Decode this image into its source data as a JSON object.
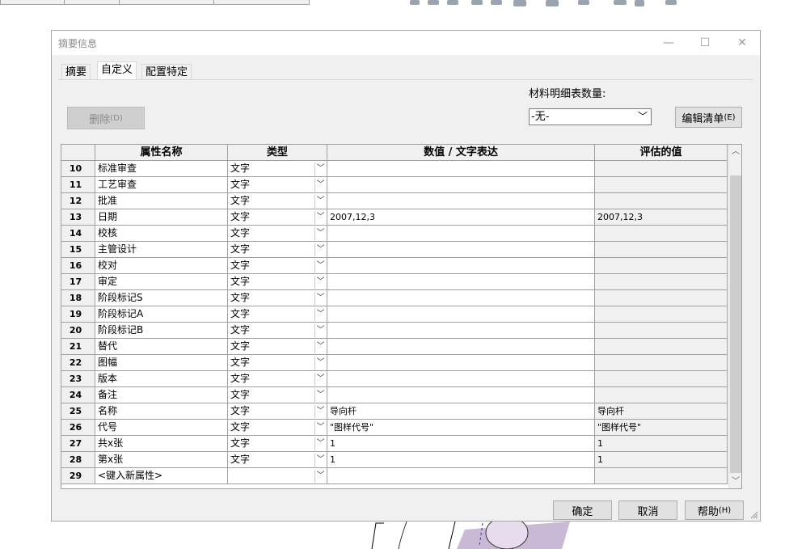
{
  "dialog": {
    "title": "摘要信息",
    "window_controls": {
      "minimize": "—",
      "maximize": "☐",
      "close": "✕"
    }
  },
  "tabs": [
    {
      "label": "摘要",
      "active": false
    },
    {
      "label": "自定义",
      "active": true
    },
    {
      "label": "配置特定",
      "active": false
    }
  ],
  "toolbar": {
    "delete_label": "删除",
    "delete_shortcut": "(D)",
    "bom_label": "材料明细表数量:",
    "bom_value": "-无-",
    "edit_label": "编辑清单",
    "edit_shortcut": "(E)"
  },
  "grid": {
    "headers": {
      "name": "属性名称",
      "type": "类型",
      "value": "数值 / 文字表达",
      "evaluated": "评估的值"
    },
    "rows": [
      {
        "num": "10",
        "name": "标准审查",
        "type": "文字",
        "value": "",
        "evaluated": ""
      },
      {
        "num": "11",
        "name": "工艺审查",
        "type": "文字",
        "value": "",
        "evaluated": ""
      },
      {
        "num": "12",
        "name": "批准",
        "type": "文字",
        "value": "",
        "evaluated": ""
      },
      {
        "num": "13",
        "name": "日期",
        "type": "文字",
        "value": "2007,12,3",
        "evaluated": "2007,12,3"
      },
      {
        "num": "14",
        "name": "校核",
        "type": "文字",
        "value": "",
        "evaluated": ""
      },
      {
        "num": "15",
        "name": "主管设计",
        "type": "文字",
        "value": "",
        "evaluated": ""
      },
      {
        "num": "16",
        "name": "校对",
        "type": "文字",
        "value": "",
        "evaluated": ""
      },
      {
        "num": "17",
        "name": "审定",
        "type": "文字",
        "value": "",
        "evaluated": ""
      },
      {
        "num": "18",
        "name": "阶段标记S",
        "type": "文字",
        "value": "",
        "evaluated": ""
      },
      {
        "num": "19",
        "name": "阶段标记A",
        "type": "文字",
        "value": "",
        "evaluated": ""
      },
      {
        "num": "20",
        "name": "阶段标记B",
        "type": "文字",
        "value": "",
        "evaluated": ""
      },
      {
        "num": "21",
        "name": "替代",
        "type": "文字",
        "value": "",
        "evaluated": ""
      },
      {
        "num": "22",
        "name": "图幅",
        "type": "文字",
        "value": "",
        "evaluated": ""
      },
      {
        "num": "23",
        "name": "版本",
        "type": "文字",
        "value": "",
        "evaluated": ""
      },
      {
        "num": "24",
        "name": "备注",
        "type": "文字",
        "value": "",
        "evaluated": ""
      },
      {
        "num": "25",
        "name": "名称",
        "type": "文字",
        "value": "导向杆",
        "evaluated": "导向杆"
      },
      {
        "num": "26",
        "name": "代号",
        "type": "文字",
        "value": "\"图样代号\"",
        "evaluated": "\"图样代号\""
      },
      {
        "num": "27",
        "name": "共x张",
        "type": "文字",
        "value": "1",
        "evaluated": "1"
      },
      {
        "num": "28",
        "name": "第x张",
        "type": "文字",
        "value": "1",
        "evaluated": "1"
      },
      {
        "num": "29",
        "name": "<键入新属性>",
        "type": "",
        "value": "",
        "evaluated": ""
      }
    ]
  },
  "footer": {
    "ok_label": "确定",
    "cancel_label": "取消",
    "help_label": "帮助",
    "help_shortcut": "(H)"
  },
  "colors": {
    "dialog_bg": "#f0f0f0",
    "grid_line": "#a0a0a0",
    "readonly_cell": "#f0f0f0"
  }
}
